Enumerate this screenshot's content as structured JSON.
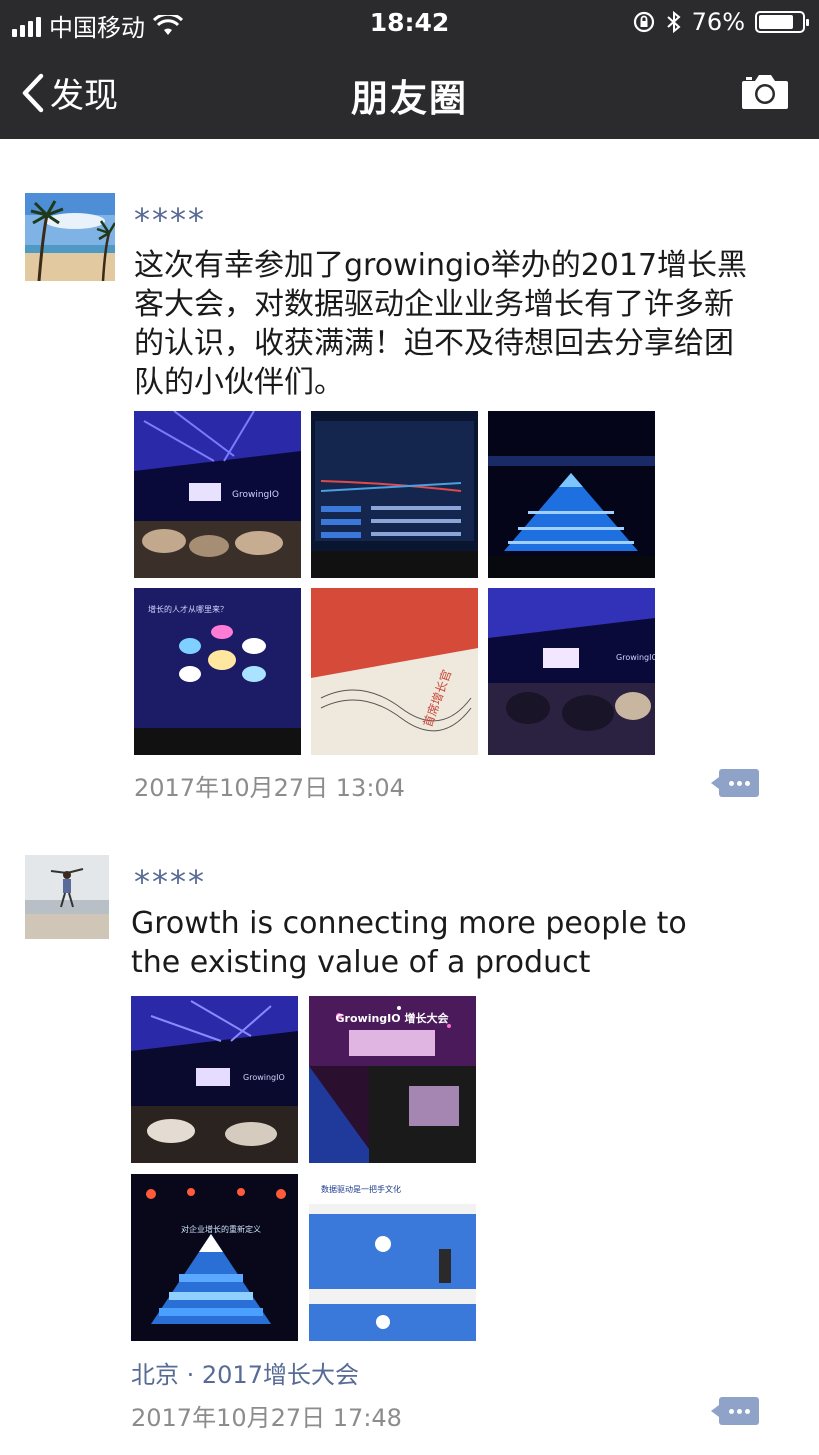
{
  "status_bar": {
    "carrier": "中国移动",
    "time": "18:42",
    "battery": "76%"
  },
  "nav": {
    "back_label": "发现",
    "title": "朋友圈"
  },
  "posts": [
    {
      "nickname": "****",
      "text": "这次有幸参加了growingio举办的2017增长黑客大会，对数据驱动企业业务增长有了许多新的认识，收获满满！迫不及待想回去分享给团队的小伙伴们。",
      "timestamp": "2017年10月27日 13:04",
      "photos": [
        {
          "label": "GrowingIO"
        },
        {
          "label": ""
        },
        {
          "label": ""
        },
        {
          "label": "增长的人才从哪里来？"
        },
        {
          "label": "首席增长官"
        },
        {
          "label": "GrowingIO"
        }
      ]
    },
    {
      "nickname": "****",
      "text": "Growth is connecting more people to the existing value of a product",
      "location": "北京 · 2017增长大会",
      "timestamp": "2017年10月27日 17:48",
      "photos": [
        {
          "label": "GrowingIO"
        },
        {
          "label": "GrowingIO 增长大会"
        },
        {
          "label": "对企业增长的重新定义"
        },
        {
          "label": "数据驱动是一把手文化"
        }
      ]
    }
  ],
  "icons": {
    "back": "chevron-left-icon",
    "camera": "camera-icon",
    "comment": "comment-icon",
    "wifi": "wifi-icon",
    "bluetooth": "bluetooth-icon",
    "lock": "rotation-lock-icon"
  }
}
